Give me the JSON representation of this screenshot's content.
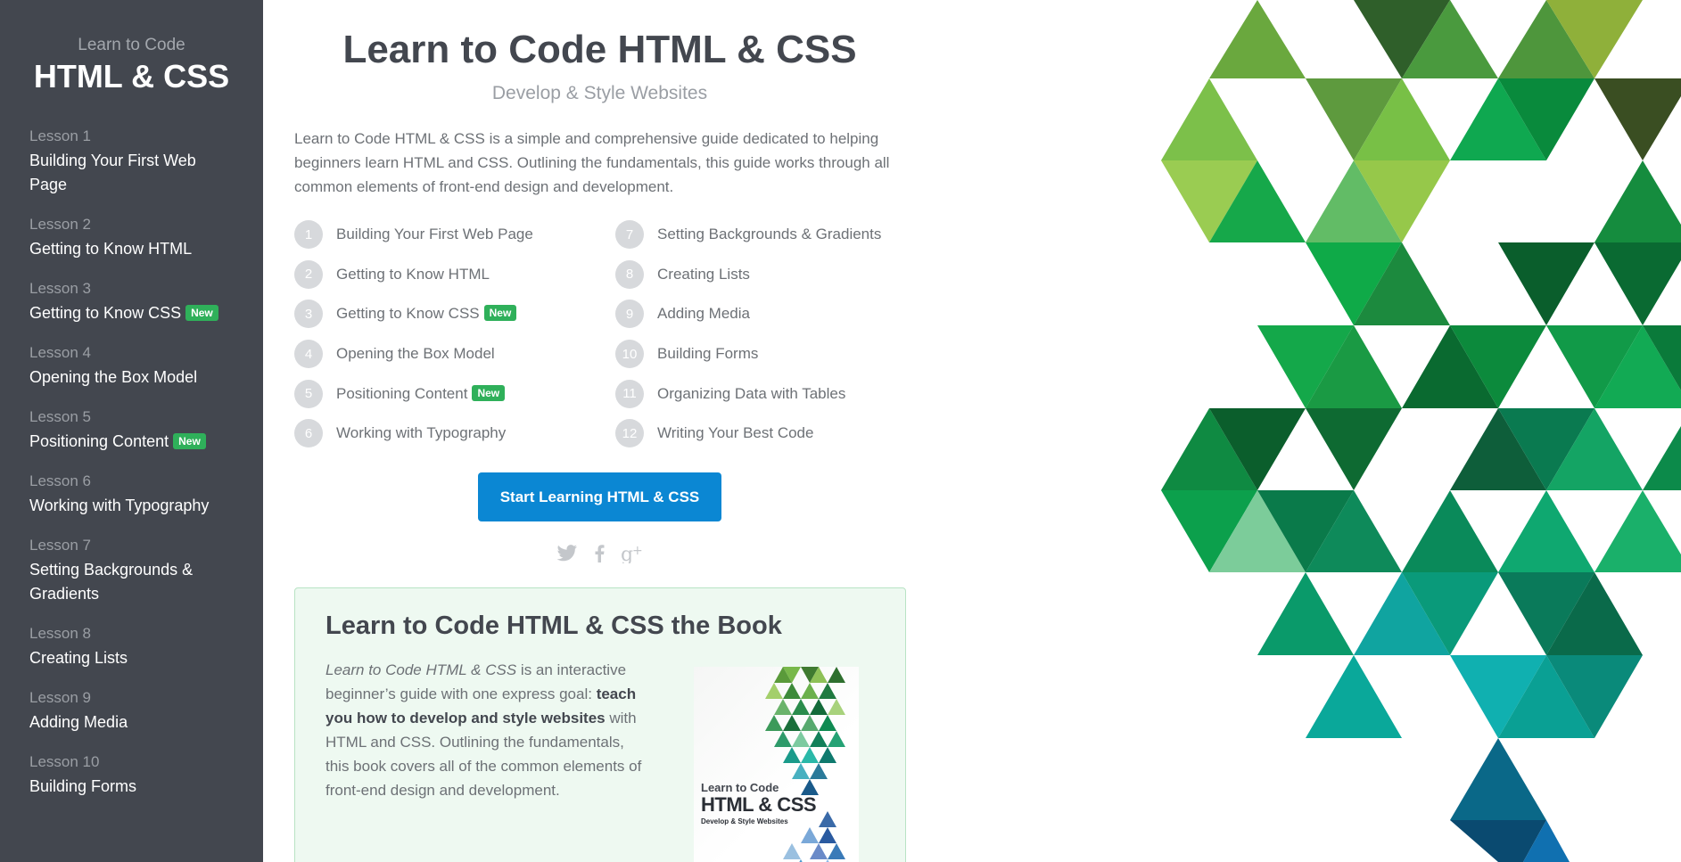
{
  "sidebar": {
    "brand_small": "Learn to Code",
    "brand_big": "HTML & CSS",
    "items": [
      {
        "num": "Lesson 1",
        "title": "Building Your First Web Page",
        "badge": ""
      },
      {
        "num": "Lesson 2",
        "title": "Getting to Know HTML",
        "badge": ""
      },
      {
        "num": "Lesson 3",
        "title": "Getting to Know CSS",
        "badge": "New"
      },
      {
        "num": "Lesson 4",
        "title": "Opening the Box Model",
        "badge": ""
      },
      {
        "num": "Lesson 5",
        "title": "Positioning Content",
        "badge": "New"
      },
      {
        "num": "Lesson 6",
        "title": "Working with Typography",
        "badge": ""
      },
      {
        "num": "Lesson 7",
        "title": "Setting Backgrounds & Gradients",
        "badge": ""
      },
      {
        "num": "Lesson 8",
        "title": "Creating Lists",
        "badge": ""
      },
      {
        "num": "Lesson 9",
        "title": "Adding Media",
        "badge": ""
      },
      {
        "num": "Lesson 10",
        "title": "Building Forms",
        "badge": ""
      }
    ]
  },
  "main": {
    "title": "Learn to Code HTML & CSS",
    "subtitle": "Develop & Style Websites",
    "intro": "Learn to Code HTML & CSS is a simple and comprehensive guide dedicated to helping beginners learn HTML and CSS. Outlining the fundamentals, this guide works through all common elements of front-end design and development.",
    "lessons_left": [
      {
        "n": "1",
        "title": "Building Your First Web Page",
        "badge": ""
      },
      {
        "n": "2",
        "title": "Getting to Know HTML",
        "badge": ""
      },
      {
        "n": "3",
        "title": "Getting to Know CSS",
        "badge": "New"
      },
      {
        "n": "4",
        "title": "Opening the Box Model",
        "badge": ""
      },
      {
        "n": "5",
        "title": "Positioning Content",
        "badge": "New"
      },
      {
        "n": "6",
        "title": "Working with Typography",
        "badge": ""
      }
    ],
    "lessons_right": [
      {
        "n": "7",
        "title": "Setting Backgrounds & Gradients",
        "badge": ""
      },
      {
        "n": "8",
        "title": "Creating Lists",
        "badge": ""
      },
      {
        "n": "9",
        "title": "Adding Media",
        "badge": ""
      },
      {
        "n": "10",
        "title": "Building Forms",
        "badge": ""
      },
      {
        "n": "11",
        "title": "Organizing Data with Tables",
        "badge": ""
      },
      {
        "n": "12",
        "title": "Writing Your Best Code",
        "badge": ""
      }
    ],
    "cta_label": "Start Learning HTML & CSS",
    "social": [
      "twitter-icon",
      "facebook-icon",
      "google-plus-icon"
    ]
  },
  "book": {
    "heading": "Learn to Code HTML & CSS the Book",
    "text_em": "Learn to Code HTML & CSS",
    "text_1": " is an interactive beginner’s guide with one express goal: ",
    "text_strong": "teach you how to develop and style websites",
    "text_2": " with HTML and CSS. Outlining the fundamentals, this book covers all of the common elements of front-end design and development.",
    "cover_line1": "Learn to Code",
    "cover_line2": "HTML & CSS",
    "cover_line3": "Develop & Style Websites"
  },
  "colors": {
    "sidebar_bg": "#43474f",
    "accent_blue": "#0b87d3",
    "badge_green": "#2fb05a",
    "book_bg": "#eef9f1"
  }
}
